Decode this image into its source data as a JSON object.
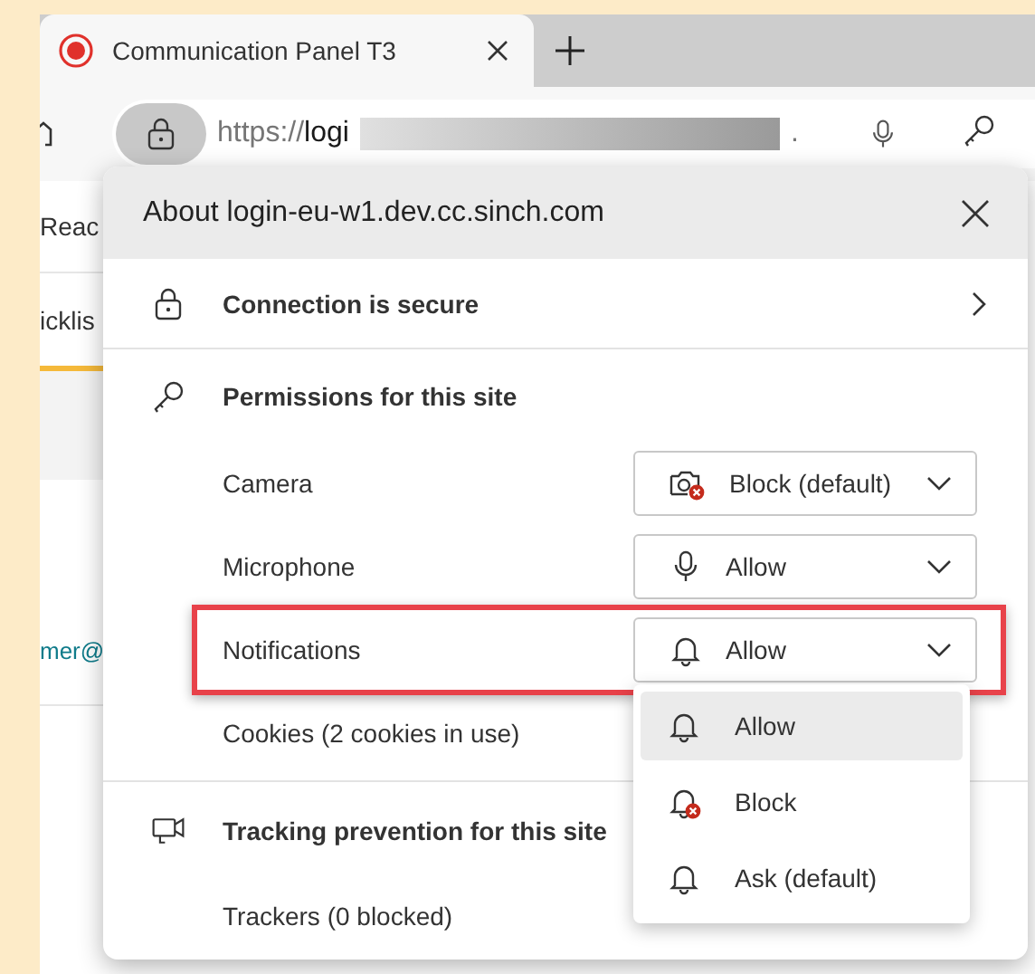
{
  "tab": {
    "title": "Communication Panel T3",
    "selected": true
  },
  "address_bar": {
    "scheme": "https://",
    "host": "logi",
    "tail": "."
  },
  "page_fragments": {
    "left": [
      {
        "text": "Reac",
        "kind": "plain"
      },
      {
        "text": "icklis",
        "kind": "tab"
      },
      {
        "text": "mer@",
        "kind": "link"
      }
    ]
  },
  "popup": {
    "title": "About login-eu-w1.dev.cc.sinch.com",
    "connection": "Connection is secure",
    "permissions_heading": "Permissions for this site",
    "permissions": [
      {
        "label": "Camera",
        "value": "Block (default)",
        "kind": "camera"
      },
      {
        "label": "Microphone",
        "value": "Allow",
        "kind": "microphone"
      },
      {
        "label": "Notifications",
        "value": "Allow",
        "kind": "notifications",
        "highlighted": true,
        "expanded": true
      },
      {
        "label": "Cookies (2 cookies in use)"
      }
    ],
    "tracking_heading": "Tracking prevention for this site",
    "trackers": "Trackers (0 blocked)"
  },
  "dropdown_menu": [
    {
      "label": "Allow",
      "kind": "allow",
      "selected": true
    },
    {
      "label": "Block",
      "kind": "block",
      "selected": false
    },
    {
      "label": "Ask (default)",
      "kind": "ask",
      "selected": false
    }
  ]
}
